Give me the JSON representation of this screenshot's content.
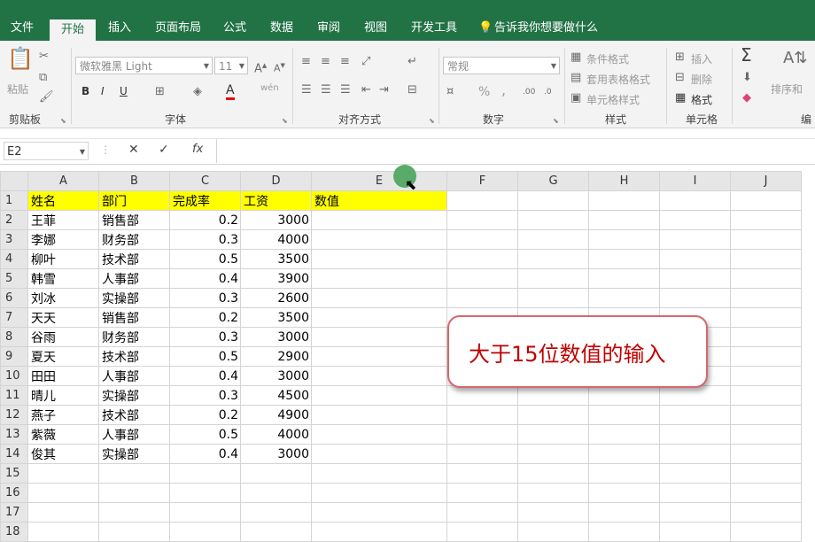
{
  "tabs": {
    "file": "文件",
    "home": "开始",
    "insert": "插入",
    "layout": "页面布局",
    "formulas": "公式",
    "data": "数据",
    "review": "审阅",
    "view": "视图",
    "developer": "开发工具",
    "tell_me": "告诉我你想要做什么"
  },
  "ribbon": {
    "clipboard": {
      "paste": "粘贴",
      "label": "剪贴板"
    },
    "font": {
      "name": "微软雅黑 Light",
      "size": "11",
      "label": "字体",
      "bold": "B",
      "italic": "I",
      "underline": "U",
      "font_color": "A",
      "phonetic": "wén"
    },
    "alignment": {
      "label": "对齐方式"
    },
    "number": {
      "format": "常规",
      "label": "数字",
      "percent": "%",
      "comma": ","
    },
    "styles": {
      "conditional": "条件格式",
      "table": "套用表格格式",
      "cell": "单元格样式",
      "label": "样式"
    },
    "cells": {
      "insert": "插入",
      "delete": "删除",
      "format": "格式",
      "label": "单元格"
    },
    "editing": {
      "sort": "排序和",
      "label": "编"
    }
  },
  "formula_bar": {
    "name_box": "E2",
    "cancel": "✕",
    "confirm": "✓",
    "fx": "fx",
    "value": ""
  },
  "columns": [
    "A",
    "B",
    "C",
    "D",
    "E",
    "F",
    "G",
    "H",
    "I",
    "J"
  ],
  "header_row": [
    "姓名",
    "部门",
    "完成率",
    "工资",
    "数值"
  ],
  "rows": [
    [
      "王菲",
      "销售部",
      "0.2",
      "3000"
    ],
    [
      "李娜",
      "财务部",
      "0.3",
      "4000"
    ],
    [
      "柳叶",
      "技术部",
      "0.5",
      "3500"
    ],
    [
      "韩雪",
      "人事部",
      "0.4",
      "3900"
    ],
    [
      "刘冰",
      "实操部",
      "0.3",
      "2600"
    ],
    [
      "天天",
      "销售部",
      "0.2",
      "3500"
    ],
    [
      "谷雨",
      "财务部",
      "0.3",
      "3000"
    ],
    [
      "夏天",
      "技术部",
      "0.5",
      "2900"
    ],
    [
      "田田",
      "人事部",
      "0.4",
      "3000"
    ],
    [
      "晴儿",
      "实操部",
      "0.3",
      "4500"
    ],
    [
      "燕子",
      "技术部",
      "0.2",
      "4900"
    ],
    [
      "紫薇",
      "人事部",
      "0.5",
      "4000"
    ],
    [
      "俊其",
      "实操部",
      "0.4",
      "3000"
    ]
  ],
  "row_numbers": [
    "1",
    "2",
    "3",
    "4",
    "5",
    "6",
    "7",
    "8",
    "9",
    "10",
    "11",
    "12",
    "13",
    "14",
    "15",
    "16",
    "17",
    "18"
  ],
  "callout": {
    "text": "大于15位数值的输入"
  },
  "colors": {
    "accent": "#217346",
    "header_fill": "#ffff00",
    "callout_text": "#c00000"
  }
}
